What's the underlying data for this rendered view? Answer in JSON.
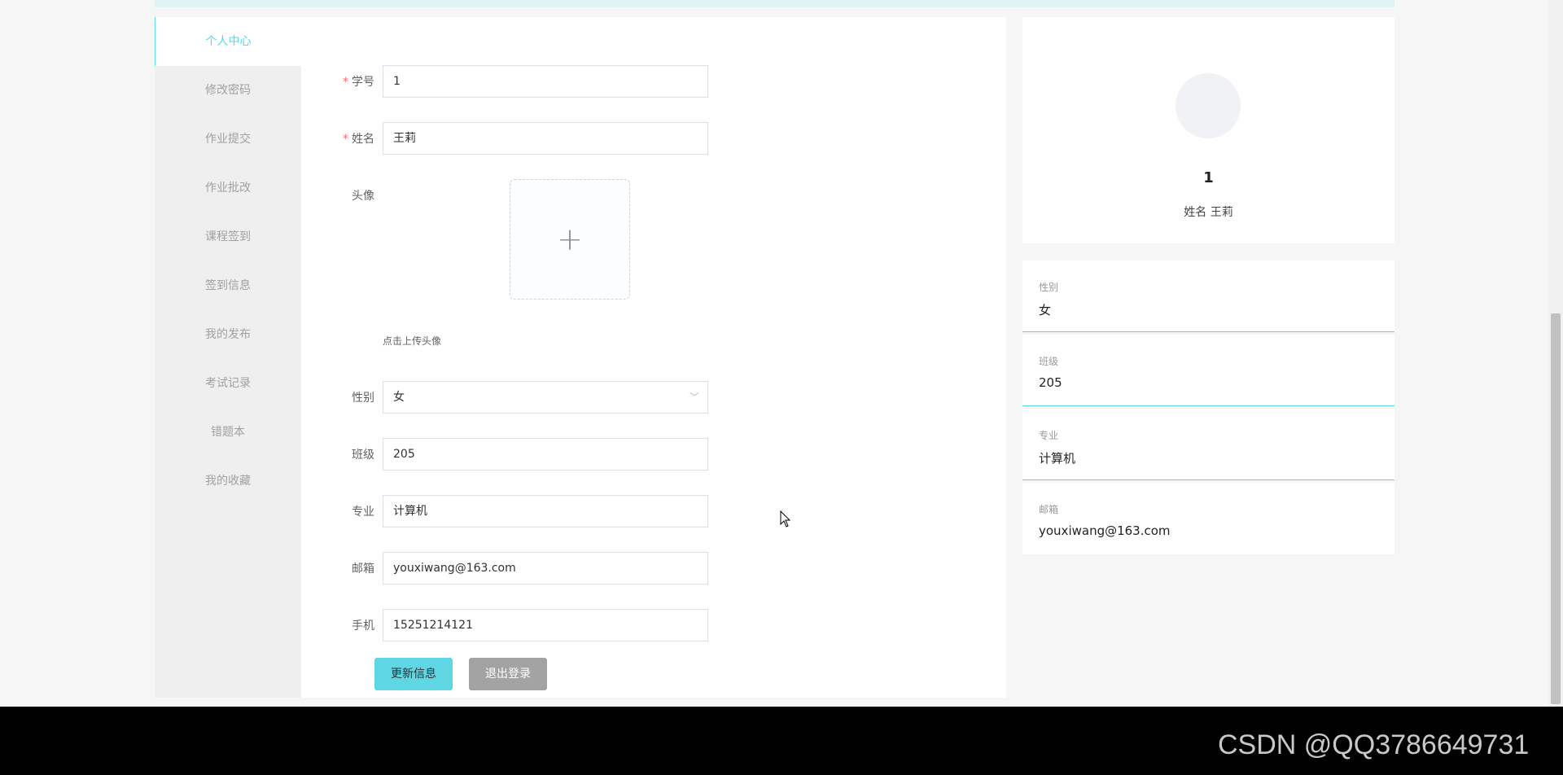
{
  "sidebar": {
    "items": [
      {
        "label": "个人中心",
        "active": true
      },
      {
        "label": "修改密码"
      },
      {
        "label": "作业提交"
      },
      {
        "label": "作业批改"
      },
      {
        "label": "课程签到"
      },
      {
        "label": "签到信息"
      },
      {
        "label": "我的发布"
      },
      {
        "label": "考试记录"
      },
      {
        "label": "错题本"
      },
      {
        "label": "我的收藏"
      }
    ]
  },
  "form": {
    "student_id": {
      "label": "学号",
      "value": "1",
      "required": true
    },
    "name": {
      "label": "姓名",
      "value": "王莉",
      "required": true
    },
    "avatar": {
      "label": "头像",
      "upload_tip": "点击上传头像",
      "icon": "plus-icon"
    },
    "gender": {
      "label": "性别",
      "value": "女",
      "icon": "chevron-down-icon"
    },
    "class": {
      "label": "班级",
      "value": "205"
    },
    "major": {
      "label": "专业",
      "value": "计算机"
    },
    "email": {
      "label": "邮箱",
      "value": "youxiwang@163.com"
    },
    "phone": {
      "label": "手机",
      "value": "15251214121"
    },
    "update_button": "更新信息",
    "logout_button": "退出登录"
  },
  "profile_card": {
    "id": "1",
    "name_label": "姓名",
    "name_value": "王莉"
  },
  "info_cards": [
    {
      "label": "性别",
      "value": "女"
    },
    {
      "label": "班级",
      "value": "205"
    },
    {
      "label": "专业",
      "value": "计算机"
    },
    {
      "label": "邮箱",
      "value": "youxiwang@163.com"
    }
  ],
  "watermark": "CSDN @QQ3786649731",
  "colors": {
    "accent": "#5fd6e3",
    "secondary_button": "#a3a3a3",
    "sidebar_bg": "#efefef",
    "required": "#f56c6c"
  }
}
